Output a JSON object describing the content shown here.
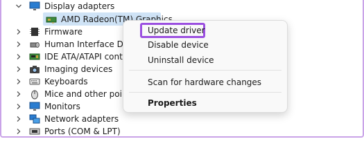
{
  "tree": {
    "items": [
      {
        "label": "Display adapters",
        "icon": "monitor-icon"
      },
      {
        "label": "AMD Radeon(TM) Graphics",
        "icon": "display-adapter-icon"
      },
      {
        "label": "Firmware",
        "icon": "firmware-chip-icon"
      },
      {
        "label": "Human Interface Dev",
        "icon": "hid-icon"
      },
      {
        "label": "IDE ATA/ATAPI contro",
        "icon": "ide-controller-icon"
      },
      {
        "label": "Imaging devices",
        "icon": "camera-icon"
      },
      {
        "label": "Keyboards",
        "icon": "keyboard-icon"
      },
      {
        "label": "Mice and other point",
        "icon": "mouse-icon"
      },
      {
        "label": "Monitors",
        "icon": "monitor-icon"
      },
      {
        "label": "Network adapters",
        "icon": "network-icon"
      },
      {
        "label": "Ports (COM & LPT)",
        "icon": "port-icon"
      }
    ]
  },
  "context_menu": {
    "items": [
      {
        "label": "Update driver"
      },
      {
        "label": "Disable device"
      },
      {
        "label": "Uninstall device"
      },
      {
        "label": "Scan for hardware changes"
      },
      {
        "label": "Properties"
      }
    ]
  },
  "colors": {
    "highlight_border": "#9b4fe0",
    "selection": "#cfe3f6",
    "frame_border": "#c9a3e8"
  }
}
